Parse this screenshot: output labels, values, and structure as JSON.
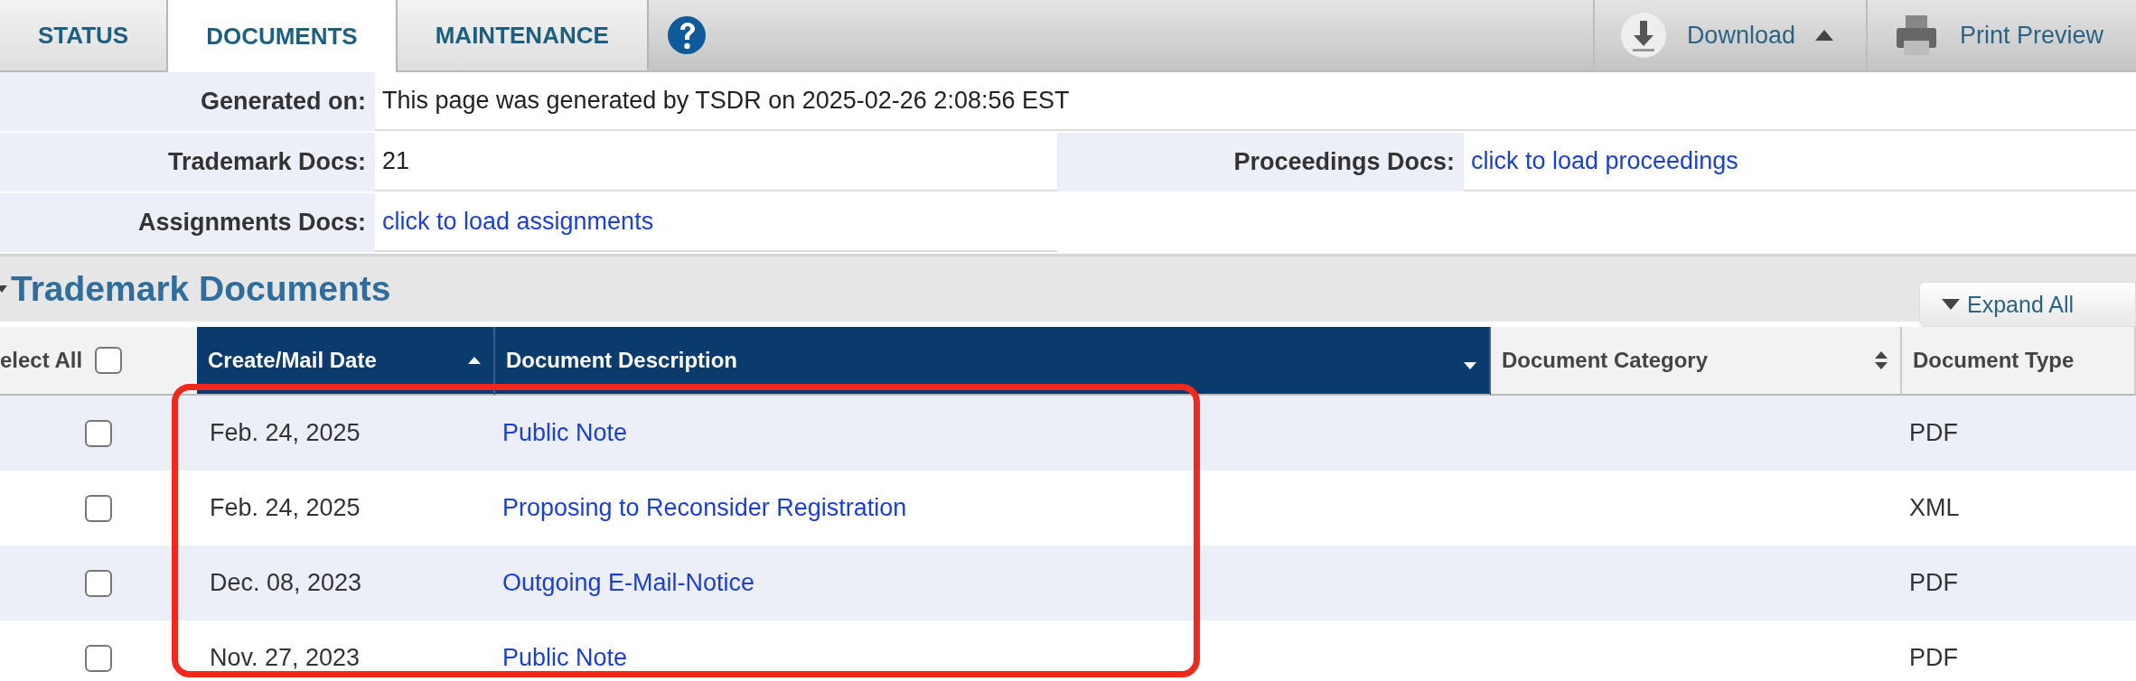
{
  "tabs": [
    {
      "label": "STATUS",
      "selected": false
    },
    {
      "label": "DOCUMENTS",
      "selected": true
    },
    {
      "label": "MAINTENANCE",
      "selected": false
    }
  ],
  "toolbar": [
    {
      "kind": "download",
      "label": "Download"
    },
    {
      "kind": "print",
      "label": "Print Preview"
    }
  ],
  "info": {
    "generated": {
      "label": "Generated on:",
      "value": "This page was generated by TSDR on 2025-02-26 2:08:56 EST"
    },
    "trademark_docs": {
      "label": "Trademark Docs:",
      "value": "21"
    },
    "proceedings_docs": {
      "label": "Proceedings Docs:",
      "link": "click to load proceedings"
    },
    "assignments_docs": {
      "label": "Assignments Docs:",
      "link": "click to load assignments"
    }
  },
  "section": {
    "title": "Trademark Documents",
    "expand_button": "Expand All"
  },
  "table": {
    "select_all": {
      "label": "elect All",
      "checked": false
    },
    "columns": [
      {
        "label": "Create/Mail Date",
        "kind": "asc",
        "active": true
      },
      {
        "label": "Document Description",
        "kind": "desc",
        "active": true
      },
      {
        "label": "Document Category",
        "kind": "both",
        "active": false
      },
      {
        "label": "Document Type",
        "active": false
      }
    ],
    "rows": [
      {
        "checked": false,
        "date": "Feb. 24, 2025",
        "description": "Public Note",
        "type": "PDF"
      },
      {
        "checked": false,
        "date": "Feb. 24, 2025",
        "description": "Proposing to Reconsider Registration",
        "type": "XML"
      },
      {
        "checked": false,
        "date": "Dec. 08, 2023",
        "description": "Outgoing E-Mail-Notice",
        "type": "PDF"
      },
      {
        "checked": false,
        "date": "Nov. 27, 2023",
        "description": "Public Note",
        "type": "PDF"
      }
    ]
  }
}
